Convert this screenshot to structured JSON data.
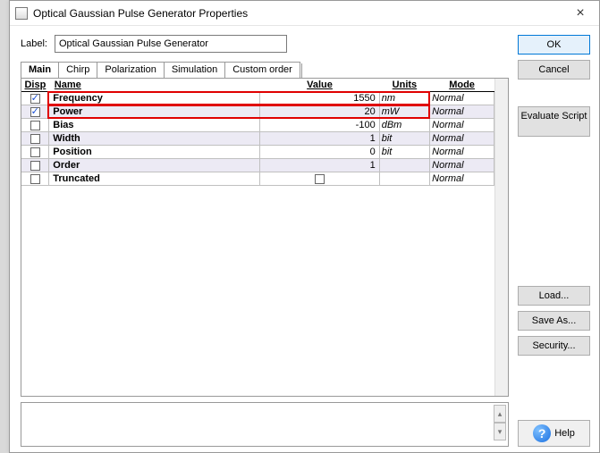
{
  "window": {
    "title": "Optical Gaussian Pulse Generator Properties"
  },
  "label": {
    "caption": "Label:",
    "value": "Optical Gaussian Pulse Generator"
  },
  "tabs": [
    "Main",
    "Chirp",
    "Polarization",
    "Simulation",
    "Custom order"
  ],
  "active_tab": 0,
  "columns": {
    "disp": "Disp",
    "name": "Name",
    "value": "Value",
    "units": "Units",
    "mode": "Mode"
  },
  "rows": [
    {
      "disp": true,
      "name": "Frequency",
      "value": "1550",
      "units": "nm",
      "mode": "Normal",
      "hl": true,
      "alt": false
    },
    {
      "disp": true,
      "name": "Power",
      "value": "20",
      "units": "mW",
      "mode": "Normal",
      "hl": true,
      "alt": true
    },
    {
      "disp": false,
      "name": "Bias",
      "value": "-100",
      "units": "dBm",
      "mode": "Normal",
      "hl": false,
      "alt": false
    },
    {
      "disp": false,
      "name": "Width",
      "value": "1",
      "units": "bit",
      "mode": "Normal",
      "hl": false,
      "alt": true
    },
    {
      "disp": false,
      "name": "Position",
      "value": "0",
      "units": "bit",
      "mode": "Normal",
      "hl": false,
      "alt": false
    },
    {
      "disp": false,
      "name": "Order",
      "value": "1",
      "units": "",
      "mode": "Normal",
      "hl": false,
      "alt": true
    },
    {
      "disp": false,
      "name": "Truncated",
      "value": "",
      "units": "",
      "mode": "Normal",
      "hl": false,
      "alt": false,
      "checkbox": true
    }
  ],
  "buttons": {
    "ok": "OK",
    "cancel": "Cancel",
    "evaluate": "Evaluate Script",
    "load": "Load...",
    "saveas": "Save As...",
    "security": "Security...",
    "help": "Help"
  },
  "colwidths": {
    "disp": 30,
    "name": 230,
    "value": 130,
    "units": 55,
    "mode": 70
  },
  "highlight_color": "#e00000"
}
